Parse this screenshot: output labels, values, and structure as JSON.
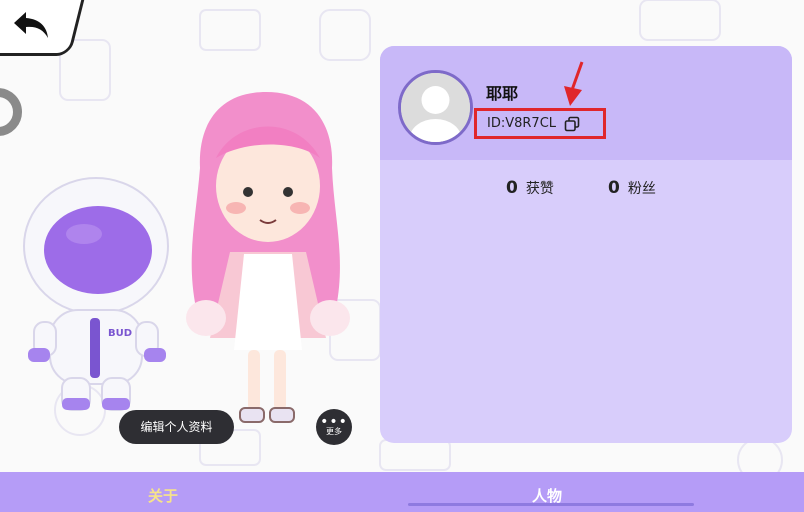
{
  "profile": {
    "username": "耶耶",
    "user_id": "ID:V8R7CL"
  },
  "stats": [
    {
      "value": "0",
      "label": "获赞"
    },
    {
      "value": "0",
      "label": "粉丝"
    }
  ],
  "actions": {
    "edit_profile": "编辑个人资料",
    "more_dots": "•••",
    "more_label": "更多"
  },
  "tabs": [
    {
      "label": "关于"
    },
    {
      "label": "人物"
    }
  ],
  "icons": [
    "back-arrow-icon",
    "copy-icon",
    "avatar-placeholder-icon",
    "more-icon"
  ],
  "colors": {
    "accent": "#b59cf7",
    "card_bg": "#d8cdfb",
    "card_header": "#c8b8f8",
    "highlight_box": "#e0262b",
    "active_tab": "#f6e38a"
  }
}
